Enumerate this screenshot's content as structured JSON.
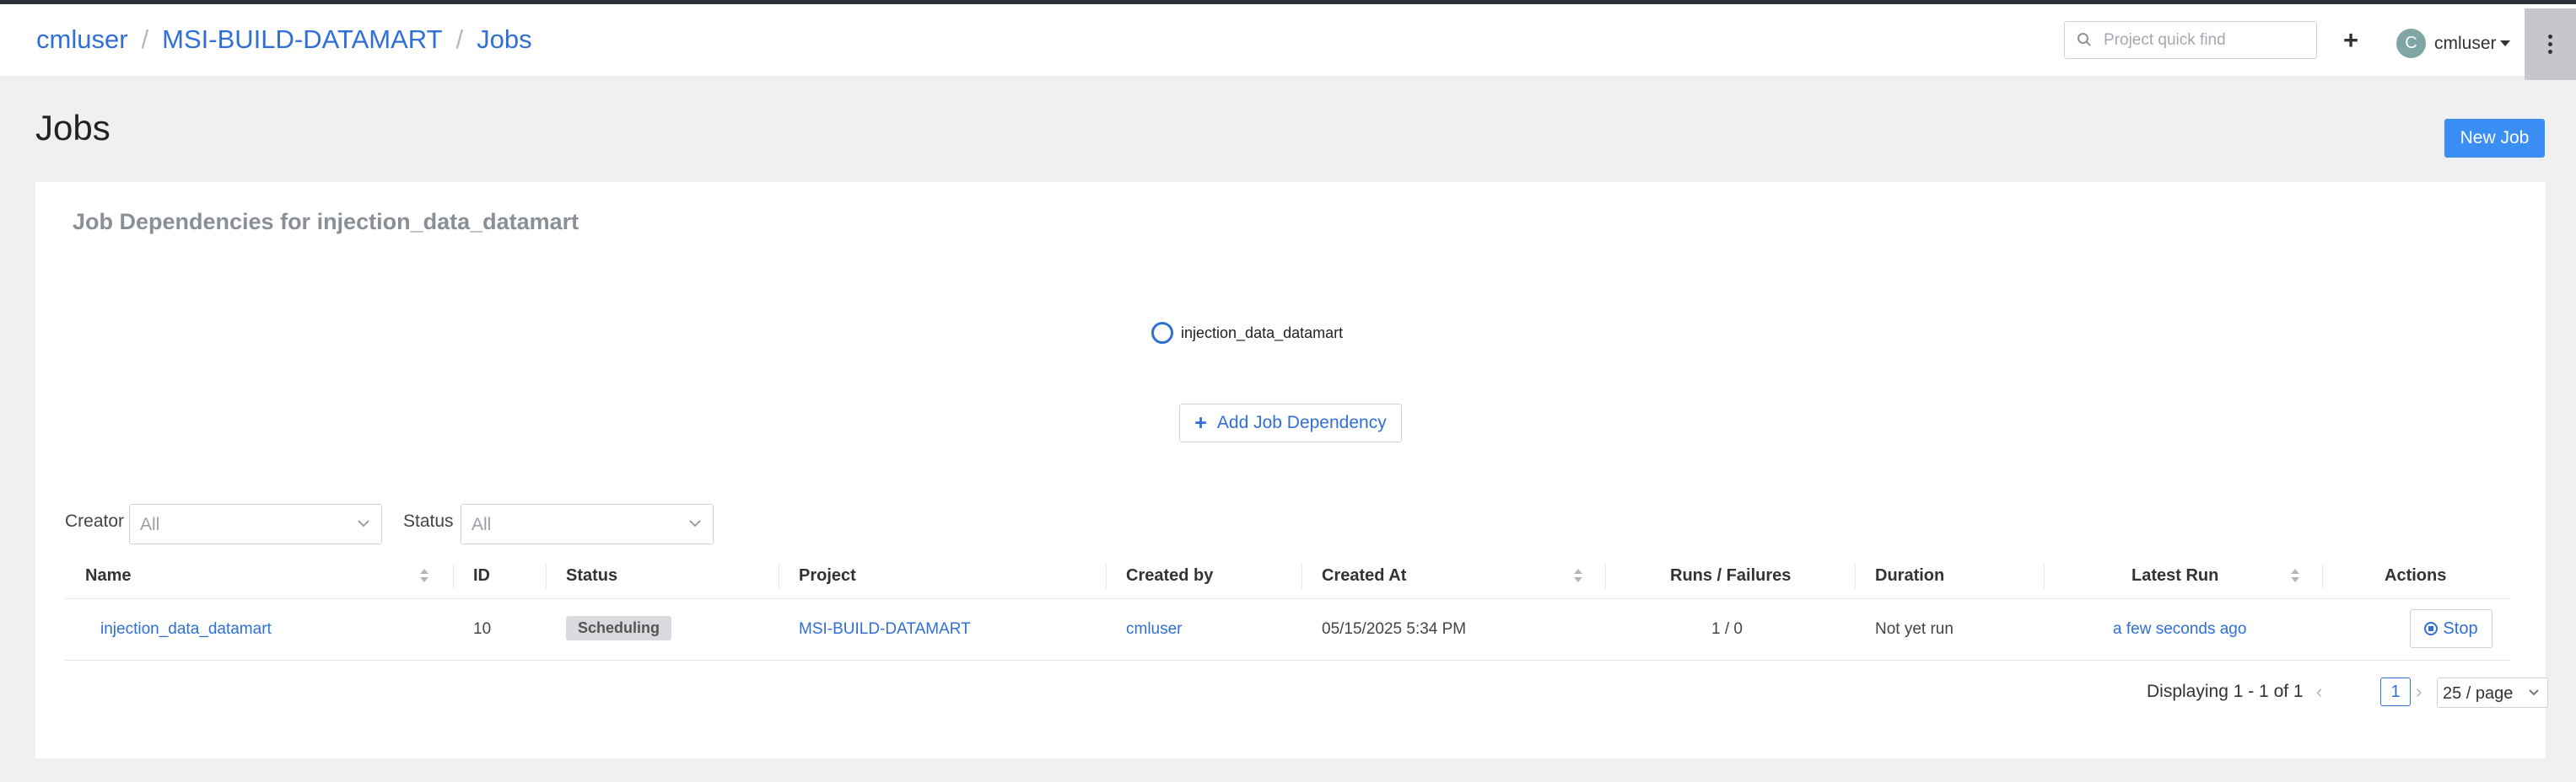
{
  "header": {
    "breadcrumb": [
      "cmluser",
      "MSI-BUILD-DATAMART",
      "Jobs"
    ],
    "search_placeholder": "Project quick find",
    "add_label": "+",
    "user": {
      "initial": "C",
      "name": "cmluser"
    }
  },
  "page": {
    "title": "Jobs",
    "new_job_label": "New Job"
  },
  "dependencies": {
    "title": "Job Dependencies for injection_data_datamart",
    "node_label": "injection_data_datamart",
    "add_label": "Add Job Dependency"
  },
  "filters": {
    "creator_label": "Creator",
    "creator_value": "All",
    "status_label": "Status",
    "status_value": "All"
  },
  "table": {
    "columns": [
      "Name",
      "ID",
      "Status",
      "Project",
      "Created by",
      "Created At",
      "Runs / Failures",
      "Duration",
      "Latest Run",
      "Actions"
    ],
    "rows": [
      {
        "name": "injection_data_datamart",
        "id": "10",
        "status": "Scheduling",
        "project": "MSI-BUILD-DATAMART",
        "created_by": "cmluser",
        "created_at": "05/15/2025 5:34 PM",
        "runs_failures": "1 / 0",
        "duration": "Not yet run",
        "latest_run": "a few seconds ago",
        "action": "Stop"
      }
    ]
  },
  "pagination": {
    "display_text": "Displaying 1 - 1 of 1",
    "current_page": "1",
    "page_size": "25 / page"
  }
}
